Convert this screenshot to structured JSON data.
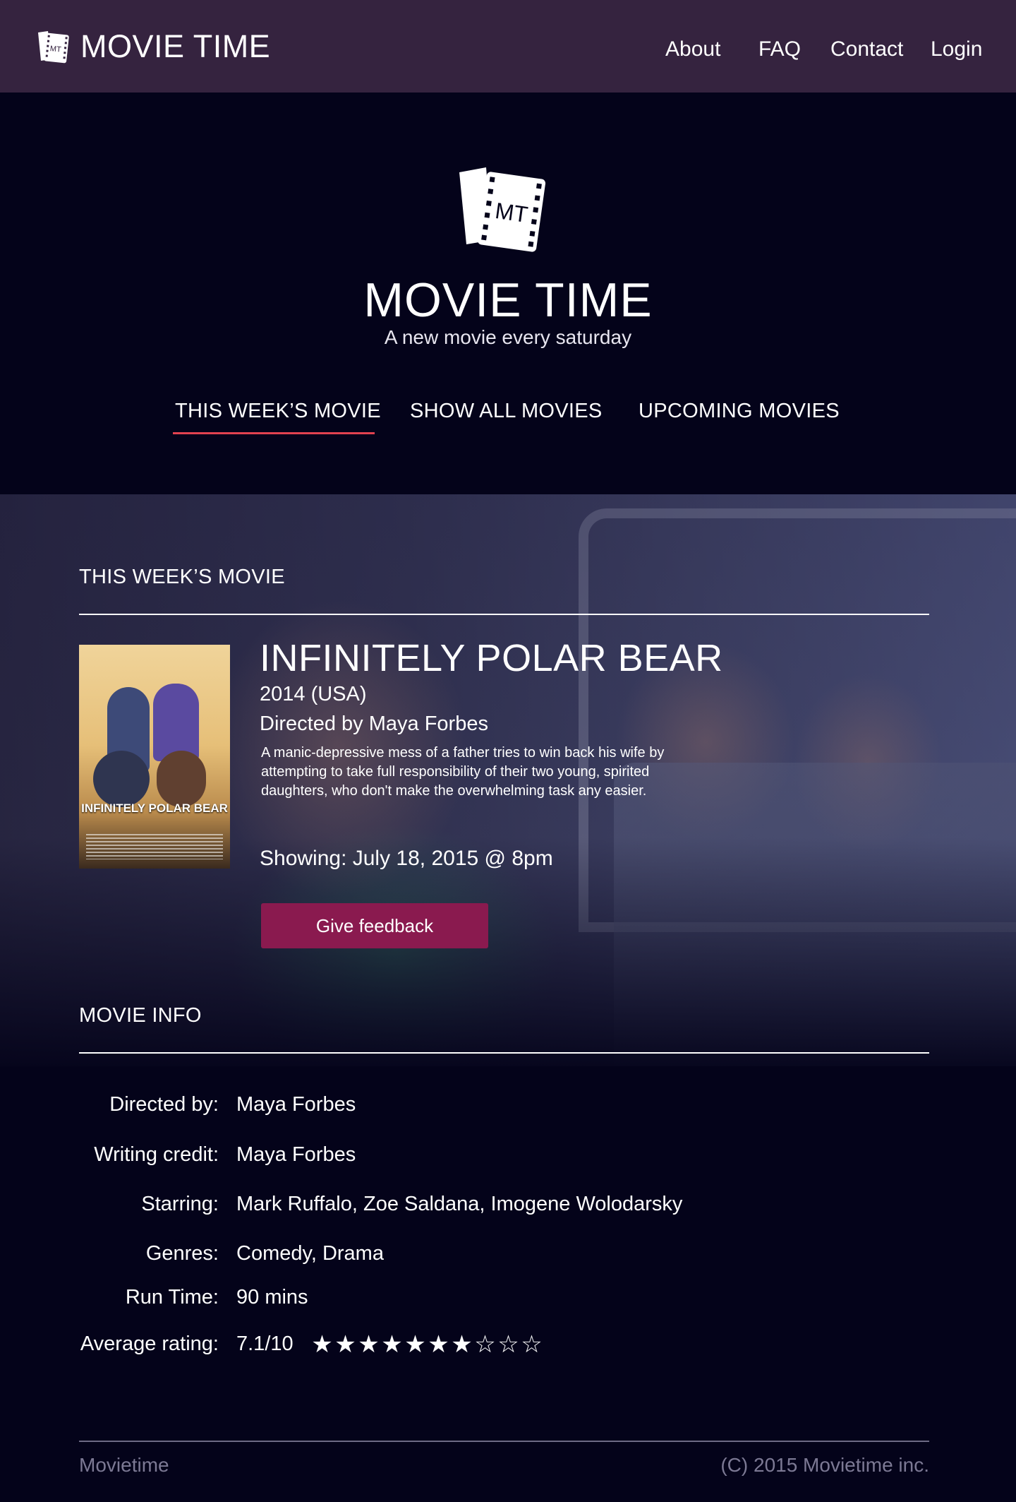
{
  "header": {
    "brand": "MOVIE TIME",
    "logo_text": "MT",
    "nav": [
      "About",
      "FAQ",
      "Contact",
      "Login"
    ]
  },
  "hero": {
    "logo_text": "MT",
    "title": "MOVIE TIME",
    "subtitle": "A new movie every saturday"
  },
  "tabs": {
    "items": [
      "THIS WEEK’S MOVIE",
      "SHOW ALL MOVIES",
      "UPCOMING MOVIES"
    ],
    "active": "THIS WEEK’S MOVIE"
  },
  "feature": {
    "section_title": "THIS WEEK’S MOVIE",
    "poster_title": "INFINITELY POLAR BEAR",
    "title": "INFINITELY POLAR BEAR",
    "year": "2014 (USA)",
    "director": "Directed by Maya Forbes",
    "synopsis": "A manic-depressive mess of a father tries to win back his wife by attempting to take full responsibility of their two young, spirited daughters, who don't make the overwhelming task any easier.",
    "showing": "Showing: July 18, 2015 @ 8pm",
    "feedback_button": "Give feedback"
  },
  "info": {
    "section_title": "MOVIE INFO",
    "rows": [
      {
        "label": "Directed by:",
        "value": "Maya Forbes"
      },
      {
        "label": "Writing credit:",
        "value": "Maya Forbes"
      },
      {
        "label": "Starring:",
        "value": "Mark Ruffalo, Zoe Saldana, Imogene Wolodarsky"
      },
      {
        "label": "Genres:",
        "value": "Comedy, Drama"
      },
      {
        "label": "Run Time:",
        "value": "90 mins"
      },
      {
        "label": "Average rating:",
        "value": "7.1/10"
      }
    ],
    "rating": {
      "filled": 7,
      "total": 10
    }
  },
  "footer": {
    "left": "Movietime",
    "right": "(C) 2015 Movietime inc."
  },
  "colors": {
    "topbar": "#35233f",
    "background": "#04031a",
    "tab_underline": "#e2424f",
    "button": "#8a1a4f",
    "footer_text": "#7c7994"
  },
  "icons": {
    "logo": "ticket-film-icon",
    "star_filled": "star-filled-icon",
    "star_empty": "star-outline-icon"
  }
}
